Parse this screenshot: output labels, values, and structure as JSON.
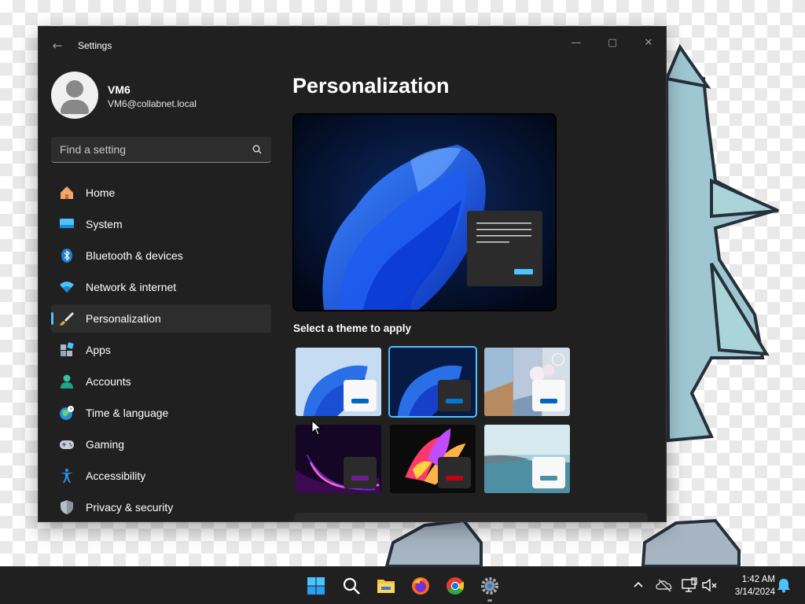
{
  "window": {
    "title": "Settings",
    "back_glyph": "←",
    "controls": {
      "minimize": "—",
      "maximize": "▢",
      "close": "✕"
    }
  },
  "user": {
    "name": "VM6",
    "email": "VM6@collabnet.local"
  },
  "search": {
    "placeholder": "Find a setting",
    "value": ""
  },
  "nav": {
    "items": [
      {
        "label": "Home",
        "icon": "home-icon"
      },
      {
        "label": "System",
        "icon": "system-icon"
      },
      {
        "label": "Bluetooth & devices",
        "icon": "bluetooth-icon"
      },
      {
        "label": "Network & internet",
        "icon": "network-icon"
      },
      {
        "label": "Personalization",
        "icon": "personalization-icon",
        "active": true
      },
      {
        "label": "Apps",
        "icon": "apps-icon"
      },
      {
        "label": "Accounts",
        "icon": "accounts-icon"
      },
      {
        "label": "Time & language",
        "icon": "time-language-icon"
      },
      {
        "label": "Gaming",
        "icon": "gaming-icon"
      },
      {
        "label": "Accessibility",
        "icon": "accessibility-icon"
      },
      {
        "label": "Privacy & security",
        "icon": "privacy-security-icon"
      }
    ]
  },
  "main": {
    "title": "Personalization",
    "themes_label": "Select a theme to apply",
    "themes": [
      {
        "name": "windows-light",
        "selected": false,
        "accent": "#0067c0"
      },
      {
        "name": "windows-dark",
        "selected": true,
        "accent": "#0067c0"
      },
      {
        "name": "windows-spotlight",
        "selected": false,
        "accent": "#0067c0"
      },
      {
        "name": "glow",
        "selected": false,
        "accent": "#6b1e8f"
      },
      {
        "name": "captured-motion",
        "selected": false,
        "accent": "#c40012"
      },
      {
        "name": "flow",
        "selected": false,
        "accent": "#4a90a4"
      }
    ]
  },
  "colors": {
    "accent": "#4cc2ff",
    "window_bg": "#202020",
    "taskbar_bg": "#202020"
  },
  "taskbar": {
    "apps": [
      "start-icon",
      "search-icon",
      "file-explorer-icon",
      "firefox-icon",
      "chrome-icon",
      "settings-icon"
    ],
    "tray": [
      "chevron-up-icon",
      "onedrive-icon",
      "network-icon",
      "volume-muted-icon",
      "notification-bell-icon"
    ],
    "time": "1:42 AM",
    "date": "3/14/2024"
  }
}
